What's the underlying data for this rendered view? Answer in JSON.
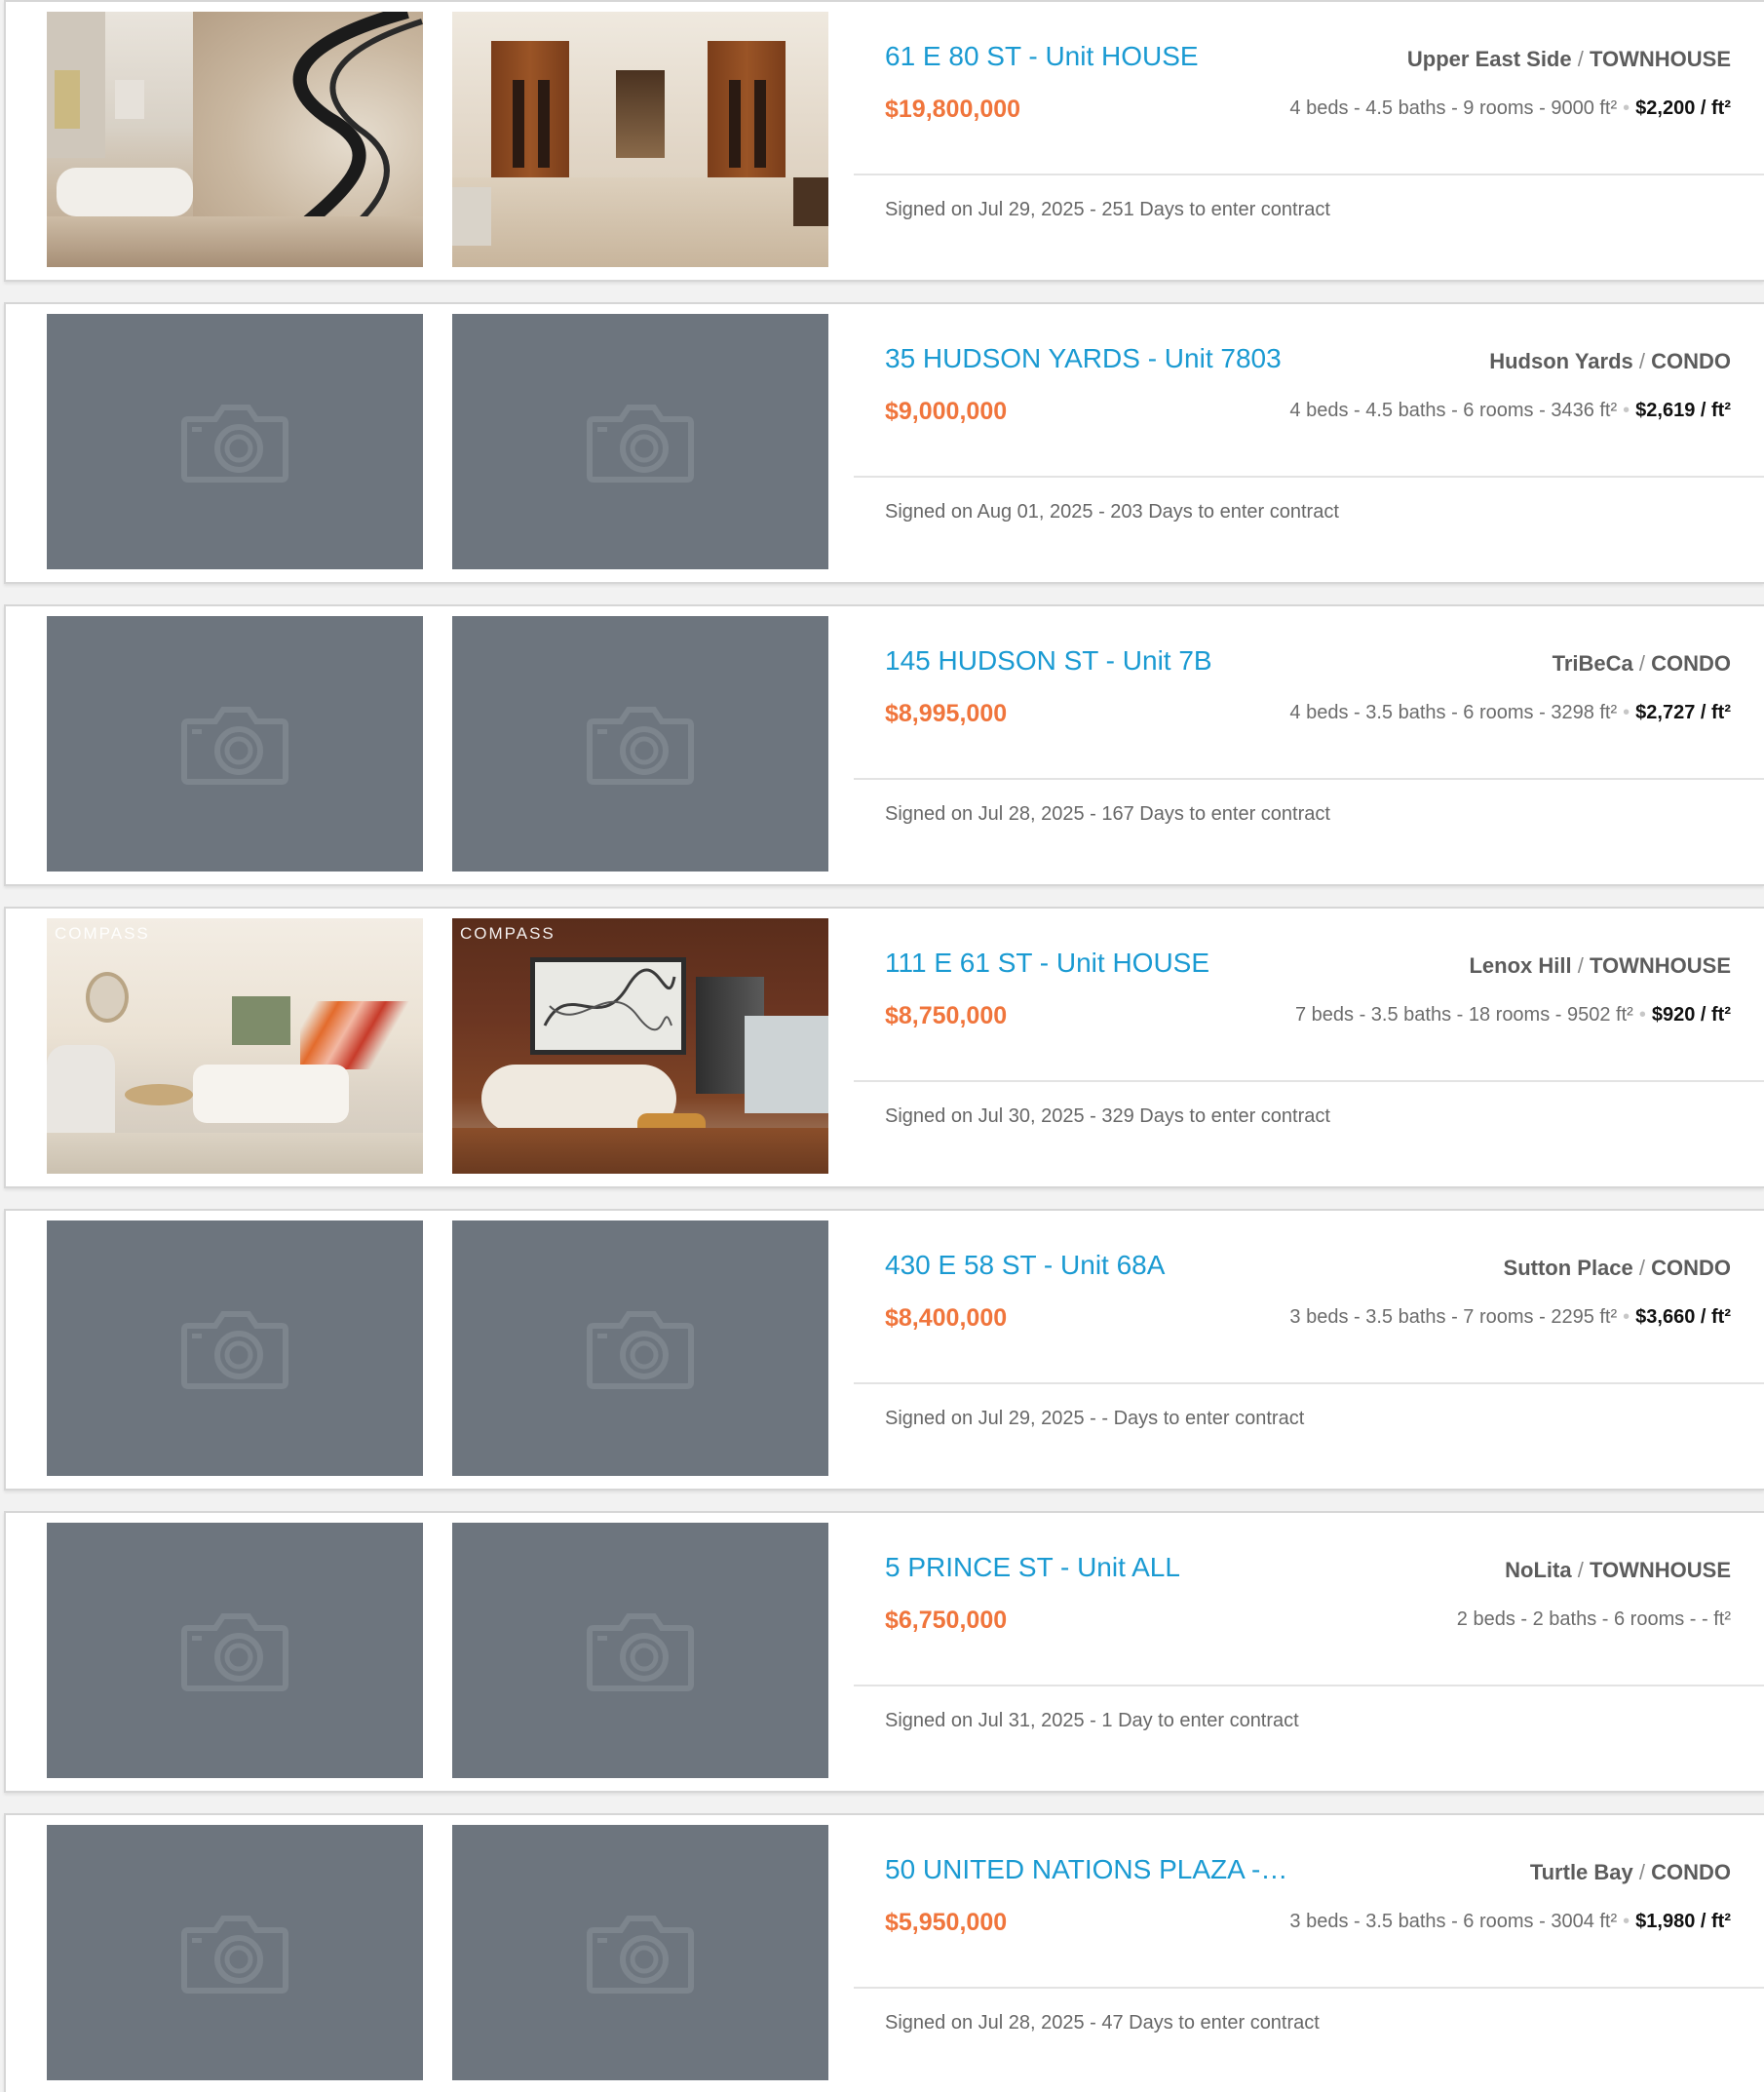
{
  "listings": [
    {
      "title": "61 E 80 ST - Unit HOUSE",
      "neighborhood": "Upper East Side",
      "type": "TOWNHOUSE",
      "price": "$19,800,000",
      "details": "4 beds - 4.5 baths - 9 rooms - 9000 ft²",
      "ppsf": "$2,200 / ft²",
      "signed": "Signed on Jul 29, 2025 - 251 Days to enter contract",
      "photos": [
        "photo",
        "photo"
      ]
    },
    {
      "title": "35 HUDSON YARDS - Unit 7803",
      "neighborhood": "Hudson Yards",
      "type": "CONDO",
      "price": "$9,000,000",
      "details": "4 beds - 4.5 baths - 6 rooms - 3436 ft²",
      "ppsf": "$2,619 / ft²",
      "signed": "Signed on Aug 01, 2025 - 203 Days to enter contract",
      "photos": [
        "placeholder",
        "placeholder"
      ]
    },
    {
      "title": "145 HUDSON ST - Unit 7B",
      "neighborhood": "TriBeCa",
      "type": "CONDO",
      "price": "$8,995,000",
      "details": "4 beds - 3.5 baths - 6 rooms - 3298 ft²",
      "ppsf": "$2,727 / ft²",
      "signed": "Signed on Jul 28, 2025 - 167 Days to enter contract",
      "photos": [
        "placeholder",
        "placeholder"
      ]
    },
    {
      "title": "111 E 61 ST - Unit HOUSE",
      "neighborhood": "Lenox Hill",
      "type": "TOWNHOUSE",
      "price": "$8,750,000",
      "details": "7 beds - 3.5 baths - 18 rooms - 9502 ft²",
      "ppsf": "$920 / ft²",
      "signed": "Signed on Jul 30, 2025 - 329 Days to enter contract",
      "photos": [
        "photo",
        "photo"
      ],
      "brand": "COMPASS"
    },
    {
      "title": "430 E 58 ST - Unit 68A",
      "neighborhood": "Sutton Place",
      "type": "CONDO",
      "price": "$8,400,000",
      "details": "3 beds - 3.5 baths - 7 rooms - 2295 ft²",
      "ppsf": "$3,660 / ft²",
      "signed": "Signed on Jul 29, 2025 - - Days to enter contract",
      "photos": [
        "placeholder",
        "placeholder"
      ]
    },
    {
      "title": "5 PRINCE ST - Unit ALL",
      "neighborhood": "NoLita",
      "type": "TOWNHOUSE",
      "price": "$6,750,000",
      "details": "2 beds - 2 baths - 6 rooms - - ft²",
      "ppsf": "",
      "signed": "Signed on Jul 31, 2025 - 1 Day to enter contract",
      "photos": [
        "placeholder",
        "placeholder"
      ]
    },
    {
      "title": "50 UNITED NATIONS PLAZA -…",
      "neighborhood": "Turtle Bay",
      "type": "CONDO",
      "price": "$5,950,000",
      "details": "3 beds - 3.5 baths - 6 rooms - 3004 ft²",
      "ppsf": "$1,980 / ft²",
      "signed": "Signed on Jul 28, 2025 - 47 Days to enter contract",
      "photos": [
        "placeholder",
        "placeholder"
      ]
    }
  ],
  "icons": {
    "placeholder": "camera-icon"
  },
  "colors": {
    "title": "#1a9ad2",
    "price": "#f0753c",
    "placeholder_bg": "#6d757e"
  }
}
